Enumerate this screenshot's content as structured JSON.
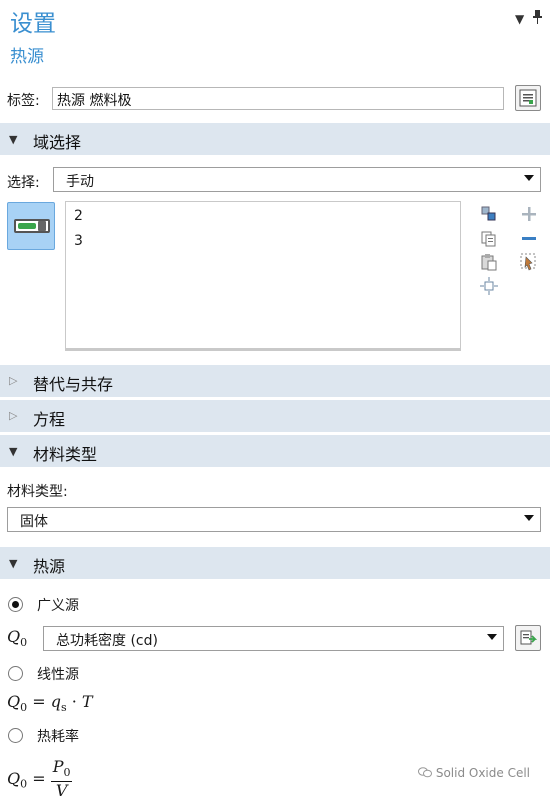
{
  "header": {
    "title": "设置",
    "subtitle": "热源"
  },
  "label_field": {
    "label": "标签:",
    "value": "热源 燃料极"
  },
  "domain_selection": {
    "section_title": "域选择",
    "select_label": "选择:",
    "select_value": "手动",
    "items": [
      "2",
      "3"
    ]
  },
  "sections": {
    "override": "替代与共存",
    "equation": "方程",
    "material_type": "材料类型",
    "heat_source": "热源"
  },
  "material_type": {
    "label": "材料类型:",
    "value": "固体"
  },
  "heat_source": {
    "options": [
      {
        "label": "广义源",
        "selected": true
      },
      {
        "label": "线性源",
        "selected": false
      },
      {
        "label": "热耗率",
        "selected": false
      }
    ],
    "q0_symbol": "Q",
    "q0_sub": "0",
    "q0_value": "总功耗密度 (cd)",
    "linear_formula": {
      "lhs": "Q",
      "lhs_sub": "0",
      "eq": "=",
      "q": "q",
      "q_sub": "s",
      "dot": "·",
      "T": "T"
    },
    "rate_formula": {
      "lhs": "Q",
      "lhs_sub": "0",
      "eq": "=",
      "num": "P",
      "num_sub": "0",
      "den": "V"
    }
  },
  "icons": {
    "collapse": "chevron-down-icon",
    "pin": "pin-icon",
    "label_edit": "text-document-icon",
    "toggle": "active-toggle-icon",
    "add": "plus-icon",
    "remove": "minus-icon",
    "copy": "copy-icon",
    "paste": "paste-icon",
    "select_region": "select-region-icon",
    "zoom_selection": "zoom-to-selection-icon",
    "clear": "clear-selection-icon",
    "go_to_source": "go-to-source-icon"
  },
  "watermark": "Solid Oxide Cell"
}
